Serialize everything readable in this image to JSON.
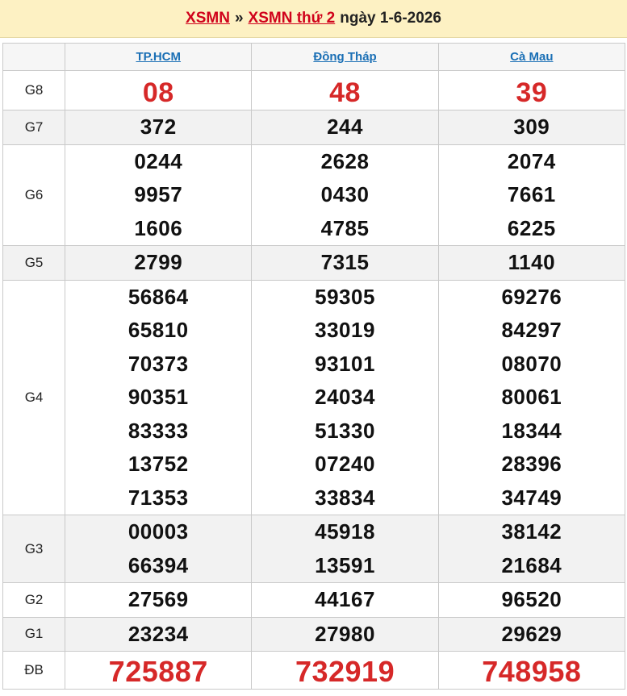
{
  "header": {
    "link1": "XSMN",
    "sep": "»",
    "link2": "XSMN thứ 2",
    "date": "ngày 1-6-2026"
  },
  "provinces": [
    "TP.HCM",
    "Đồng Tháp",
    "Cà Mau"
  ],
  "rows": [
    {
      "label": "G8",
      "results": [
        [
          "08"
        ],
        [
          "48"
        ],
        [
          "39"
        ]
      ]
    },
    {
      "label": "G7",
      "results": [
        [
          "372"
        ],
        [
          "244"
        ],
        [
          "309"
        ]
      ]
    },
    {
      "label": "G6",
      "results": [
        [
          "0244",
          "9957",
          "1606"
        ],
        [
          "2628",
          "0430",
          "4785"
        ],
        [
          "2074",
          "7661",
          "6225"
        ]
      ]
    },
    {
      "label": "G5",
      "results": [
        [
          "2799"
        ],
        [
          "7315"
        ],
        [
          "1140"
        ]
      ]
    },
    {
      "label": "G4",
      "results": [
        [
          "56864",
          "65810",
          "70373",
          "90351",
          "83333",
          "13752",
          "71353"
        ],
        [
          "59305",
          "33019",
          "93101",
          "24034",
          "51330",
          "07240",
          "33834"
        ],
        [
          "69276",
          "84297",
          "08070",
          "80061",
          "18344",
          "28396",
          "34749"
        ]
      ]
    },
    {
      "label": "G3",
      "results": [
        [
          "00003",
          "66394"
        ],
        [
          "45918",
          "13591"
        ],
        [
          "38142",
          "21684"
        ]
      ]
    },
    {
      "label": "G2",
      "results": [
        [
          "27569"
        ],
        [
          "44167"
        ],
        [
          "96520"
        ]
      ]
    },
    {
      "label": "G1",
      "results": [
        [
          "23234"
        ],
        [
          "27980"
        ],
        [
          "29629"
        ]
      ]
    },
    {
      "label": "ĐB",
      "results": [
        [
          "725887"
        ],
        [
          "732919"
        ],
        [
          "748958"
        ]
      ]
    }
  ]
}
